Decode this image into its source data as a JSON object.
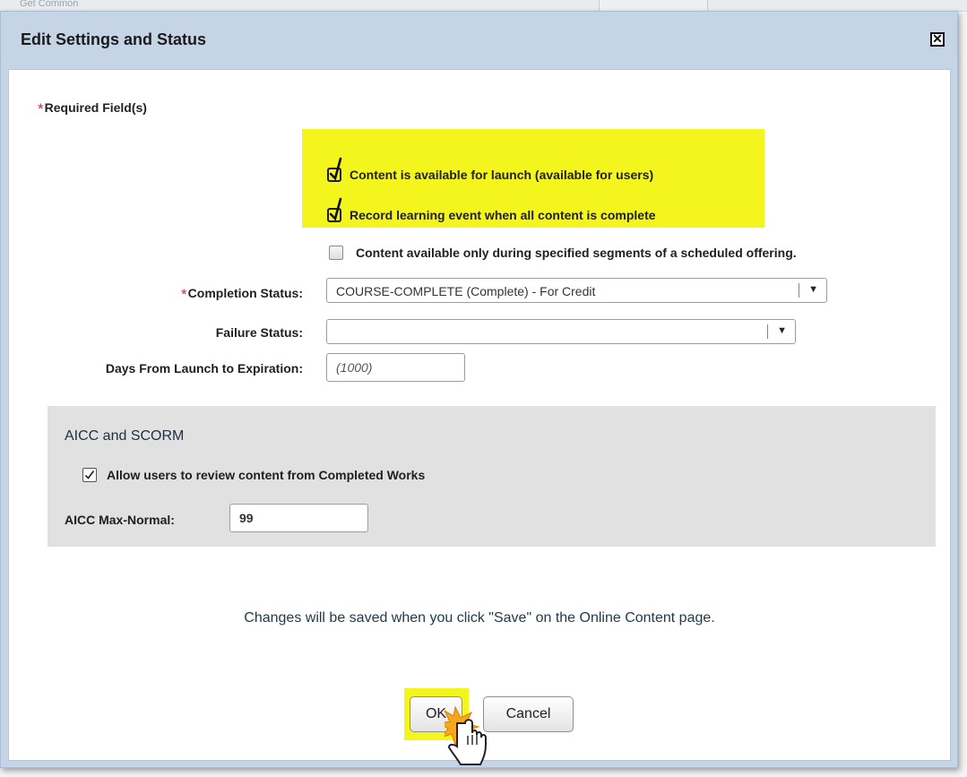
{
  "background": {
    "ghost_text": "Get Common"
  },
  "dialog": {
    "title": "Edit Settings and Status",
    "close_icon": "close-icon",
    "required_note": "Required Field(s)",
    "required_marker": "*",
    "checkboxes": [
      {
        "label": "Content is available for launch (available for users)",
        "checked": true,
        "highlighted": true
      },
      {
        "label": "Record learning event when all content is complete",
        "checked": true,
        "highlighted": true
      },
      {
        "label": "Content available only during specified segments of a scheduled offering.",
        "checked": false,
        "highlighted": false
      }
    ],
    "completion_status": {
      "label": "Completion Status:",
      "value": "COURSE-COMPLETE (Complete) - For Credit",
      "required": true
    },
    "failure_status": {
      "label": "Failure Status:",
      "value": ""
    },
    "days_to_expiration": {
      "label": "Days From Launch to Expiration:",
      "placeholder": "(1000)"
    },
    "aicc_panel": {
      "title": "AICC and SCORM",
      "review_checkbox": {
        "label": "Allow users to review content from Completed Works",
        "checked": true
      },
      "max_normal": {
        "label": "AICC Max-Normal:",
        "value": "99"
      }
    },
    "notice": "Changes will be saved when you click \"Save\" on the Online Content page.",
    "ok_label": "OK",
    "cancel_label": "Cancel"
  },
  "colors": {
    "highlight": "#f5f51e",
    "required_star": "#d4252b",
    "titlebar": "#c6d5e6"
  }
}
